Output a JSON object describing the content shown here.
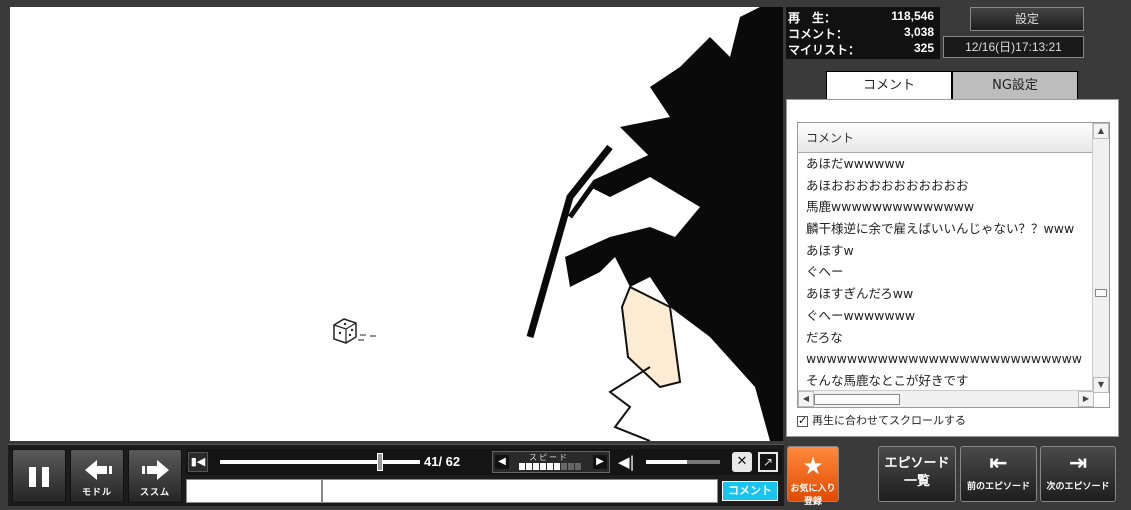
{
  "player": {
    "back_label": "モドル",
    "forward_label": "ススム",
    "time": "41/ 62",
    "seek_progress": 0.8,
    "speed_label": "スピード",
    "speed_level": 6,
    "speed_levels_total": 9,
    "volume_level": 0.55,
    "comment_button": "コメント"
  },
  "stats": {
    "views_label": "再　生：",
    "views": "118,546",
    "comments_label": "コメント：",
    "comments": "3,038",
    "mylist_label": "マイリスト：",
    "mylist": "325"
  },
  "settings_button": "設定",
  "datetime": "12/16(日)17:13:21",
  "tabs": {
    "comment": "コメント",
    "ng": "NG設定"
  },
  "comment_list": {
    "header": "コメント",
    "rows": [
      "あほだwwwwww",
      "あほおおおおおおおおおおお",
      "馬鹿wwwwwwwwwwwwww",
      "麟干様逆に余で雇えばいいんじゃない？？www",
      "あほすw",
      "ぐへー",
      "あほすぎんだろww",
      "ぐへーwwwwwww",
      "だろな",
      "wwwwwwwwwwwwwwwwwwwwwwwwwww",
      "そんな馬鹿なとこが好きです"
    ],
    "sync_label": "再生に合わせてスクロールする",
    "sync_checked": true
  },
  "buttons": {
    "favorite": "お気に入り登録",
    "episode_list": "エピソード\n一覧",
    "prev_episode": "前のエピソード",
    "next_episode": "次のエピソード"
  }
}
